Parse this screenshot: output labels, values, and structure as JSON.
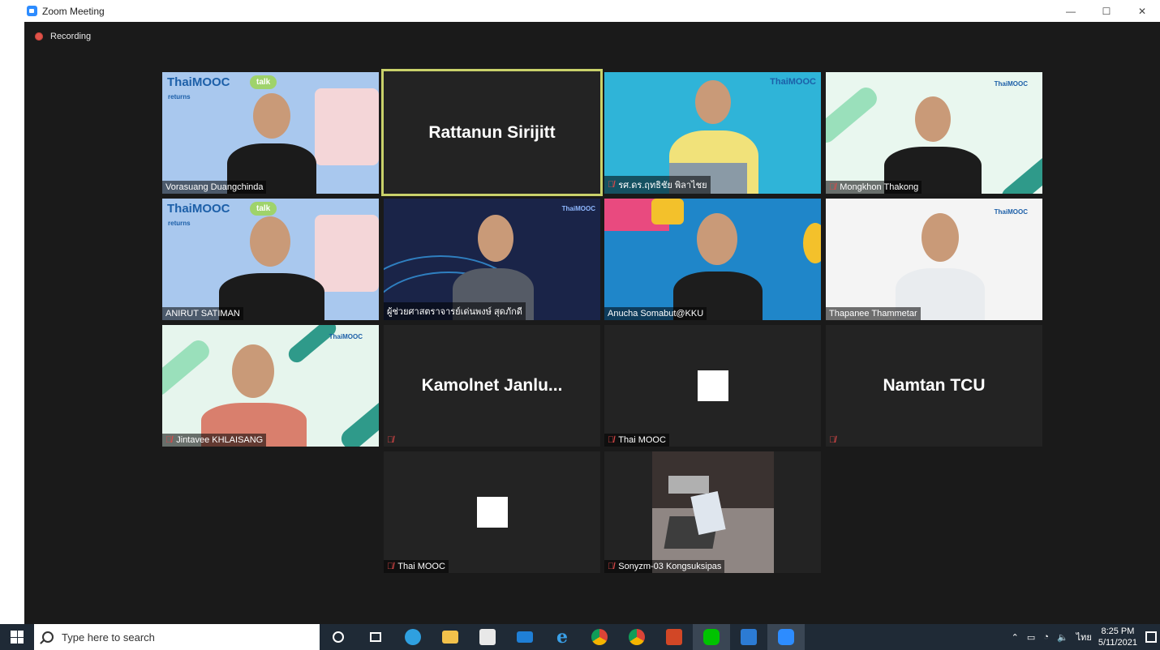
{
  "window": {
    "title": "Zoom Meeting",
    "controls": [
      "—",
      "☐",
      "✕"
    ]
  },
  "recording": {
    "label": "Recording"
  },
  "tiles": [
    {
      "name": "Vorasuang Duangchinda",
      "type": "video",
      "muted": false
    },
    {
      "name": "Rattanun Sirijitt",
      "type": "name-only",
      "active": true,
      "label": ""
    },
    {
      "name": "รศ.ดร.ฤทธิชัย พิลาไชย",
      "type": "video",
      "muted": true
    },
    {
      "name": "Mongkhon Thakong",
      "type": "video",
      "muted": true
    },
    {
      "name": "ANIRUT SATIMAN",
      "type": "video",
      "muted": false
    },
    {
      "name": "ผู้ช่วยศาสตราจารย์เด่นพงษ์ สุดภักดี",
      "type": "video",
      "muted": false
    },
    {
      "name": "Anucha Somabut@KKU",
      "type": "video",
      "muted": false
    },
    {
      "name": "Thapanee Thammetar",
      "type": "video",
      "muted": false
    },
    {
      "name": "Jintavee KHLAISANG",
      "type": "video",
      "muted": true
    },
    {
      "name": "Kamolnet   Janlu...",
      "type": "name-only",
      "muted": true,
      "label": ""
    },
    {
      "name": "Thai MOOC",
      "type": "placeholder",
      "muted": true
    },
    {
      "name": "Namtan TCU",
      "type": "name-only",
      "muted": true,
      "label": ""
    },
    {
      "name": "Thai MOOC",
      "type": "placeholder",
      "muted": true
    },
    {
      "name": "Sonyzm-03 Kongsuksipas",
      "type": "video",
      "muted": true
    }
  ],
  "branding": {
    "logo": "ThaiMOOC",
    "talk": "talk",
    "returns": "returns"
  },
  "taskbar": {
    "search_placeholder": "Type here to search",
    "apps": [
      "task-view",
      "edge",
      "file-explorer",
      "store",
      "mail",
      "internet-explorer",
      "chrome",
      "chrome-profile",
      "powerpoint",
      "line",
      "photos",
      "zoom"
    ],
    "tray_lang": "ไทย",
    "time": "8:25 PM",
    "date": "5/11/2021"
  },
  "colors": {
    "meeting_bg": "#1a1a1a",
    "tile_bg": "#232323",
    "active_speaker": "#c9d16a",
    "mic_muted": "#e04848",
    "taskbar_bg": "#1f2a36"
  }
}
